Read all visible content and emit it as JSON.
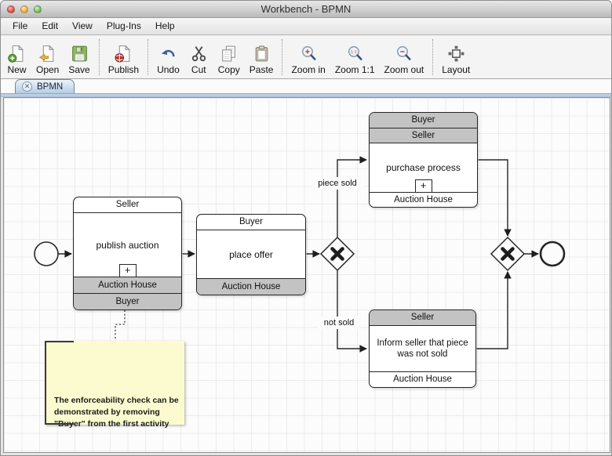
{
  "window": {
    "title": "Workbench - BPMN"
  },
  "menubar": {
    "items": [
      "File",
      "Edit",
      "View",
      "Plug-Ins",
      "Help"
    ]
  },
  "toolbar": {
    "groups": [
      {
        "items": [
          {
            "icon": "new-document-icon",
            "label": "New"
          },
          {
            "icon": "open-document-icon",
            "label": "Open"
          },
          {
            "icon": "save-icon",
            "label": "Save"
          }
        ]
      },
      {
        "items": [
          {
            "icon": "publish-icon",
            "label": "Publish"
          }
        ]
      },
      {
        "items": [
          {
            "icon": "undo-icon",
            "label": "Undo"
          },
          {
            "icon": "cut-icon",
            "label": "Cut"
          },
          {
            "icon": "copy-icon",
            "label": "Copy"
          },
          {
            "icon": "paste-icon",
            "label": "Paste"
          }
        ]
      },
      {
        "items": [
          {
            "icon": "zoom-in-icon",
            "label": "Zoom in"
          },
          {
            "icon": "zoom-actual-icon",
            "label": "Zoom 1:1"
          },
          {
            "icon": "zoom-out-icon",
            "label": "Zoom out"
          }
        ]
      },
      {
        "items": [
          {
            "icon": "layout-icon",
            "label": "Layout"
          }
        ]
      }
    ]
  },
  "tabbar": {
    "tabs": [
      {
        "label": "BPMN",
        "close_icon": "close-icon"
      }
    ]
  },
  "diagram": {
    "activities": [
      {
        "lanes_top": [
          {
            "label": "Seller",
            "shade": "white"
          }
        ],
        "body": "publish auction",
        "subprocess_marker": "+",
        "lanes_bottom": [
          {
            "label": "Auction House",
            "shade": "gray"
          },
          {
            "label": "Buyer",
            "shade": "gray"
          }
        ]
      },
      {
        "lanes_top": [
          {
            "label": "Buyer",
            "shade": "white"
          }
        ],
        "body": "place offer",
        "lanes_bottom": [
          {
            "label": "Auction House",
            "shade": "gray"
          }
        ]
      },
      {
        "lanes_top": [
          {
            "label": "Buyer",
            "shade": "gray"
          },
          {
            "label": "Seller",
            "shade": "gray"
          }
        ],
        "body": "purchase process",
        "subprocess_marker": "+",
        "lanes_bottom": [
          {
            "label": "Auction House",
            "shade": "white"
          }
        ]
      },
      {
        "lanes_top": [
          {
            "label": "Seller",
            "shade": "gray"
          }
        ],
        "body": "Inform seller that piece was not sold",
        "lanes_bottom": [
          {
            "label": "Auction House",
            "shade": "white"
          }
        ]
      }
    ],
    "events": {
      "start": "start-event",
      "end": "end-event"
    },
    "gateways": [
      "exclusive-gateway-split",
      "exclusive-gateway-merge"
    ],
    "edge_labels": {
      "sold": "piece sold",
      "not_sold": "not sold"
    },
    "annotation": {
      "text": "The enforceability check can be\ndemonstrated by removing\n\"Buyer\" from the first activity"
    }
  },
  "colors": {
    "lane_gray": "#c3c3c3",
    "note_fill": "#fbfbcf",
    "tab_blue": "#b5cde6",
    "line": "#262626"
  }
}
